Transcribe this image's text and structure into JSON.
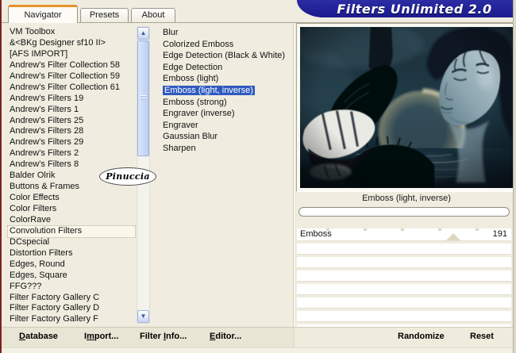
{
  "window": {
    "title": "Filters Unlimited 2.0"
  },
  "tabs": [
    {
      "label": "Navigator",
      "active": true
    },
    {
      "label": "Presets",
      "active": false
    },
    {
      "label": "About",
      "active": false
    }
  ],
  "category_list": {
    "selected": "Convolution Filters",
    "items": [
      "VM Toolbox",
      "&<BKg Designer sf10 II>",
      "[AFS IMPORT]",
      "Andrew's Filter Collection 58",
      "Andrew's Filter Collection 59",
      "Andrew's Filter Collection 61",
      "Andrew's Filters 19",
      "Andrew's Filters 1",
      "Andrew's Filters 25",
      "Andrew's Filters 28",
      "Andrew's Filters 29",
      "Andrew's Filters 2",
      "Andrew's Filters 8",
      "Balder Olrik",
      "Buttons & Frames",
      "Color Effects",
      "Color Filters",
      "ColorRave",
      "Convolution Filters",
      "DCspecial",
      "Distortion Filters",
      "Edges, Round",
      "Edges, Square",
      "FFG???",
      "Filter Factory Gallery C",
      "Filter Factory Gallery D",
      "Filter Factory Gallery F"
    ]
  },
  "filter_list": {
    "selected": "Emboss (light, inverse)",
    "items": [
      "Blur",
      "Colorized Emboss",
      "Edge Detection (Black & White)",
      "Edge Detection",
      "Emboss (light)",
      "Emboss (light, inverse)",
      "Emboss (strong)",
      "Engraver (inverse)",
      "Engraver",
      "Gaussian Blur",
      "Sharpen"
    ]
  },
  "watermark": "Pinuccia",
  "preview": {
    "caption": "Emboss (light, inverse)",
    "progress_value": 0
  },
  "parameters": {
    "rows": [
      {
        "name": "Emboss",
        "value": "191",
        "max": 255
      }
    ],
    "empty_row_count": 8
  },
  "footer": {
    "buttons": [
      {
        "label": "Database",
        "mnemonic": "D"
      },
      {
        "label": "Import...",
        "mnemonic": "m"
      },
      {
        "label": "Filter Info...",
        "mnemonic": "I"
      },
      {
        "label": "Editor...",
        "mnemonic": "E"
      },
      {
        "label": "Randomize",
        "mnemonic": ""
      },
      {
        "label": "Reset",
        "mnemonic": ""
      }
    ]
  },
  "icons": {
    "scroll_up": "▲",
    "scroll_down": "▼"
  },
  "colors": {
    "banner_navy": "#1b1b8e",
    "selection_blue": "#2f5bbf",
    "dialog_cream": "#f0ede0",
    "maroon_border": "#7a2222",
    "active_tab_stripe": "#e6912e"
  }
}
